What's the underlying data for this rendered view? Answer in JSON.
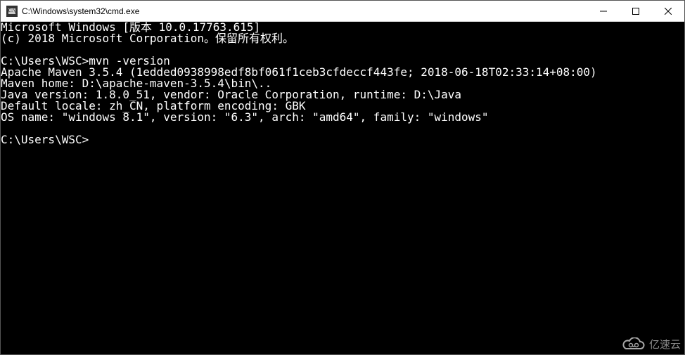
{
  "window": {
    "title": "C:\\Windows\\system32\\cmd.exe",
    "icon_label": "cmd"
  },
  "terminal": {
    "lines": [
      "Microsoft Windows [版本 10.0.17763.615]",
      "(c) 2018 Microsoft Corporation。保留所有权利。",
      "",
      "C:\\Users\\WSC>mvn -version",
      "Apache Maven 3.5.4 (1edded0938998edf8bf061f1ceb3cfdeccf443fe; 2018-06-18T02:33:14+08:00)",
      "Maven home: D:\\apache-maven-3.5.4\\bin\\..",
      "Java version: 1.8.0_51, vendor: Oracle Corporation, runtime: D:\\Java",
      "Default locale: zh_CN, platform encoding: GBK",
      "OS name: \"windows 8.1\", version: \"6.3\", arch: \"amd64\", family: \"windows\"",
      "",
      "C:\\Users\\WSC>"
    ]
  },
  "watermark": {
    "text": "亿速云"
  }
}
